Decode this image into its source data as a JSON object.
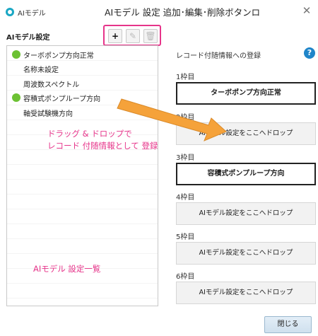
{
  "window": {
    "title": "AIモデル",
    "close_glyph": "✕"
  },
  "caption": "AIモデル 設定  追加･編集･削除ボタンロ",
  "left_panel": {
    "title": "AIモデル設定",
    "toolbar": {
      "add_glyph": "+",
      "edit_glyph": "✎",
      "delete_glyph": "🗑"
    },
    "items": [
      {
        "label": "ターボポンプ方向正常",
        "status": "green"
      },
      {
        "label": "名称未設定",
        "status": ""
      },
      {
        "label": "周波数スペクトル",
        "status": ""
      },
      {
        "label": "容積式ポンプループ方向",
        "status": "green"
      },
      {
        "label": "軸受試験機方向",
        "status": ""
      }
    ]
  },
  "annotations": {
    "drag_line1": "ドラッグ & ドロップで",
    "drag_line2": "レコード 付随情報として 登録",
    "list_caption": "AIモデル 設定一覧"
  },
  "right_panel": {
    "title": "レコード付随情報への登録",
    "help_glyph": "?",
    "slots": [
      {
        "label": "1枠目",
        "value": "ターボポンプ方向正常"
      },
      {
        "label": "2枠目",
        "value": "AIモデル設定をここへドロップ"
      },
      {
        "label": "3枠目",
        "value": "容積式ポンプループ方向"
      },
      {
        "label": "4枠目",
        "value": "AIモデル設定をここへドロップ"
      },
      {
        "label": "5枠目",
        "value": "AIモデル設定をここへドロップ"
      },
      {
        "label": "6枠目",
        "value": "AIモデル設定をここへドロップ"
      }
    ]
  },
  "footer": {
    "close_label": "閉じる"
  },
  "colors": {
    "accent_pink": "#e6348a",
    "status_green": "#6cc133",
    "arrow_orange": "#f5a23a",
    "help_blue": "#1f85c9"
  }
}
